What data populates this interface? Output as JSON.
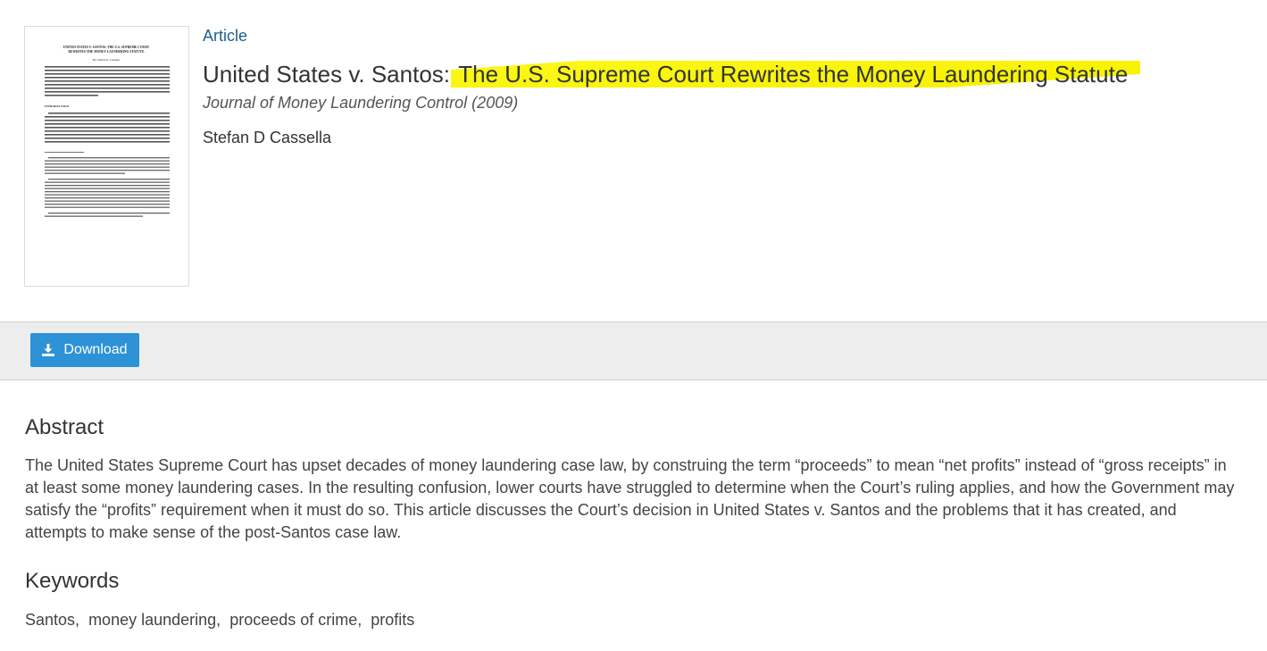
{
  "thumbnail": {
    "title_lines": [
      "UNITED STATES V. SANTOS: THE U.S. SUPREME COURT",
      "REWRITES THE MONEY LAUNDERING STATUTE"
    ],
    "byline": "By Stefan D. Cassella",
    "section": "INTRODUCTION"
  },
  "article": {
    "type_label": "Article",
    "title_plain": "United States v. Santos: ",
    "title_highlighted": "The U.S. Supreme Court Rewrites the Money Laundering Statute",
    "journal": "Journal of Money Laundering Control (2009)",
    "author": "Stefan D Cassella"
  },
  "actions": {
    "download_label": "Download",
    "download_icon": "download-icon"
  },
  "abstract": {
    "heading": "Abstract",
    "text": "The United States Supreme Court has upset decades of money laundering case law, by construing the term “proceeds” to mean “net profits” instead of “gross receipts” in at least some money laundering cases. In the resulting confusion, lower courts have struggled to determine when the Court’s ruling applies, and how the Government may satisfy the “profits” requirement when it must do so. This article discusses the Court’s decision in United States v. Santos and the problems that it has created, and attempts to make sense of the post-Santos case law."
  },
  "keywords": {
    "heading": "Keywords",
    "items": [
      "Santos,",
      "money laundering,",
      "proceeds of crime,",
      "profits"
    ]
  },
  "colors": {
    "highlight": "#f7f200",
    "button": "#2d92d6",
    "link": "#1f5e8c",
    "band": "#ededed"
  }
}
